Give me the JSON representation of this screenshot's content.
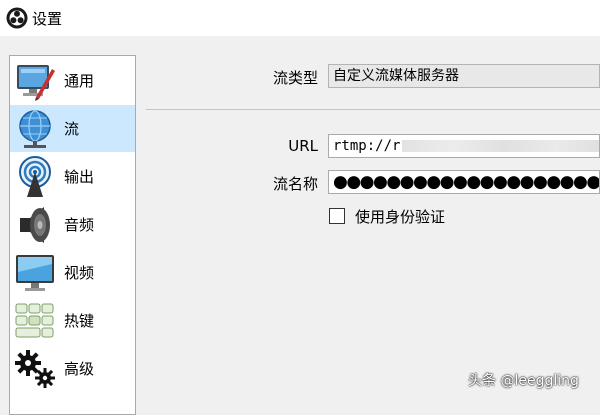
{
  "window": {
    "title": "设置",
    "app_icon": "obs-logo-icon"
  },
  "sidebar": {
    "items": [
      {
        "label": "通用",
        "icon": "monitor-with-pen-icon"
      },
      {
        "label": "流",
        "icon": "globe-network-icon",
        "selected": true
      },
      {
        "label": "输出",
        "icon": "broadcast-antenna-icon"
      },
      {
        "label": "音频",
        "icon": "speaker-icon"
      },
      {
        "label": "视频",
        "icon": "monitor-icon"
      },
      {
        "label": "热键",
        "icon": "keyboard-icon"
      },
      {
        "label": "高级",
        "icon": "gears-icon"
      }
    ]
  },
  "stream": {
    "type_label": "流类型",
    "type_value": "自定义流媒体服务器",
    "url_label": "URL",
    "url_value": "rtmp://r",
    "key_label": "流名称",
    "key_value": "●●●●●●●●●●●●●●●●●●●●",
    "auth_label": "使用身份验证",
    "auth_checked": false
  },
  "watermark": "头条 @leeggling",
  "colors": {
    "selected_bg": "#cce8ff",
    "window_bg": "#f0f0f0"
  }
}
